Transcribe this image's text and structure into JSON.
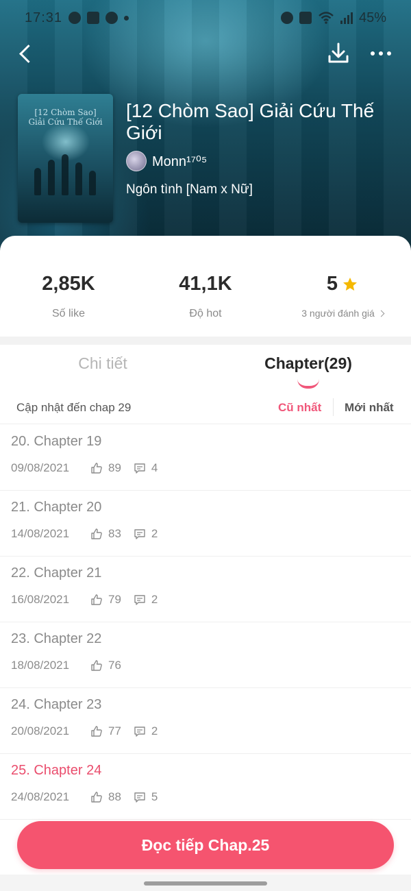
{
  "status_bar": {
    "time": "17:31",
    "battery": "45%",
    "left_icons": [
      "messenger-icon",
      "gallery-icon",
      "pinterest-icon",
      "notification-dot"
    ],
    "right_icons": [
      "alarm-icon",
      "mute-icon",
      "wifi-icon",
      "signal-icon"
    ]
  },
  "header": {
    "back_icon": "chevron-left-icon",
    "download_icon": "download-icon",
    "more_icon": "more-horizontal-icon"
  },
  "book": {
    "title": "[12 Chòm Sao] Giải Cứu Thế Giới",
    "cover_text_line1": "[12 Chòm Sao]",
    "cover_text_line2": "Giải Cứu Thế Giới",
    "author": "Monn¹⁷⁰⁵",
    "genre": "Ngôn tình [Nam x Nữ]"
  },
  "stats": {
    "likes_value": "2,85K",
    "likes_label": "Số like",
    "hot_value": "41,1K",
    "hot_label": "Độ hot",
    "rating_value": "5",
    "rating_label": "3 người đánh giá"
  },
  "tabs": {
    "details": "Chi tiết",
    "chapters": "Chapter(29)"
  },
  "chapter_header": {
    "update_text": "Cập nhật đến chap 29",
    "sort_oldest": "Cũ nhất",
    "sort_newest": "Mới nhất"
  },
  "chapters": [
    {
      "title": "20. Chapter 19",
      "date": "09/08/2021",
      "likes": "89",
      "comments": "4"
    },
    {
      "title": "21. Chapter 20",
      "date": "14/08/2021",
      "likes": "83",
      "comments": "2"
    },
    {
      "title": "22. Chapter 21",
      "date": "16/08/2021",
      "likes": "79",
      "comments": "2"
    },
    {
      "title": "23. Chapter 22",
      "date": "18/08/2021",
      "likes": "76",
      "comments": ""
    },
    {
      "title": "24. Chapter 23",
      "date": "20/08/2021",
      "likes": "77",
      "comments": "2"
    },
    {
      "title": "25. Chapter 24",
      "date": "24/08/2021",
      "likes": "88",
      "comments": "5"
    }
  ],
  "continue_button": "Đọc tiếp Chap.25",
  "colors": {
    "accent": "#f5546f",
    "accent_text": "#ea4d6d",
    "star": "#f5b800"
  }
}
